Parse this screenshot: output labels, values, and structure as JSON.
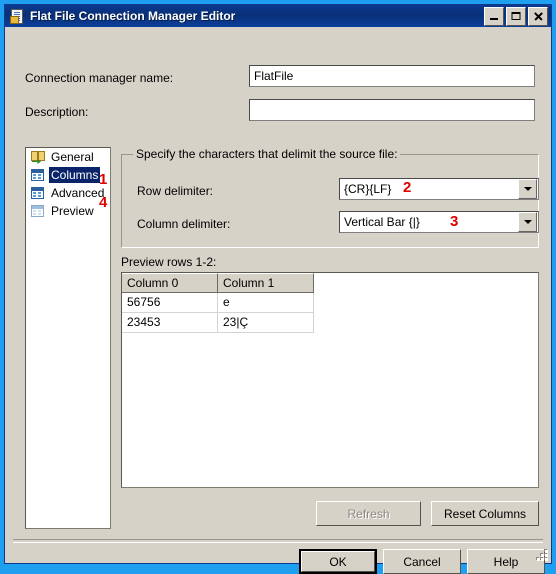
{
  "window": {
    "title": "Flat File Connection Manager Editor",
    "icon": "flat-file-document-icon",
    "controls": {
      "minimize": "Minimize",
      "maximize": "Maximize",
      "close": "Close"
    },
    "accent_titlebar": "#0b3a8f",
    "accent_frame": "#1f9ff0",
    "face": "#d6d2c8"
  },
  "form": {
    "connection_name_label": "Connection manager name:",
    "connection_name_value": "FlatFile",
    "connection_name_placeholder": "",
    "description_label": "Description:",
    "description_value": "",
    "description_placeholder": ""
  },
  "nav": {
    "items": [
      {
        "label": "General",
        "icon": "general-pages-icon",
        "selected": false
      },
      {
        "label": "Columns",
        "icon": "columns-grid-icon",
        "selected": true
      },
      {
        "label": "Advanced",
        "icon": "advanced-grid-icon",
        "selected": false
      },
      {
        "label": "Preview",
        "icon": "preview-grid-icon",
        "selected": false
      }
    ]
  },
  "delimiters": {
    "group_title": "Specify the characters that delimit the source file:",
    "row_label": "Row delimiter:",
    "row_value": "{CR}{LF}",
    "column_label": "Column delimiter:",
    "column_value": "Vertical Bar {|}"
  },
  "preview": {
    "label": "Preview rows 1-2:",
    "columns": [
      "Column 0",
      "Column 1"
    ],
    "rows": [
      [
        "56756",
        "e"
      ],
      [
        "23453",
        "23|Ç"
      ]
    ]
  },
  "actions": {
    "refresh": "Refresh",
    "refresh_enabled": false,
    "reset_columns": "Reset Columns",
    "reset_columns_enabled": true
  },
  "dialog_buttons": {
    "ok": "OK",
    "cancel": "Cancel",
    "help": "Help"
  },
  "annotations": {
    "color": "#e00000",
    "markers": [
      {
        "number": "1",
        "target": "columns-nav-item"
      },
      {
        "number": "2",
        "target": "row-delimiter-combo"
      },
      {
        "number": "3",
        "target": "column-delimiter-combo"
      },
      {
        "number": "4",
        "target": "preview-nav-item"
      }
    ]
  }
}
